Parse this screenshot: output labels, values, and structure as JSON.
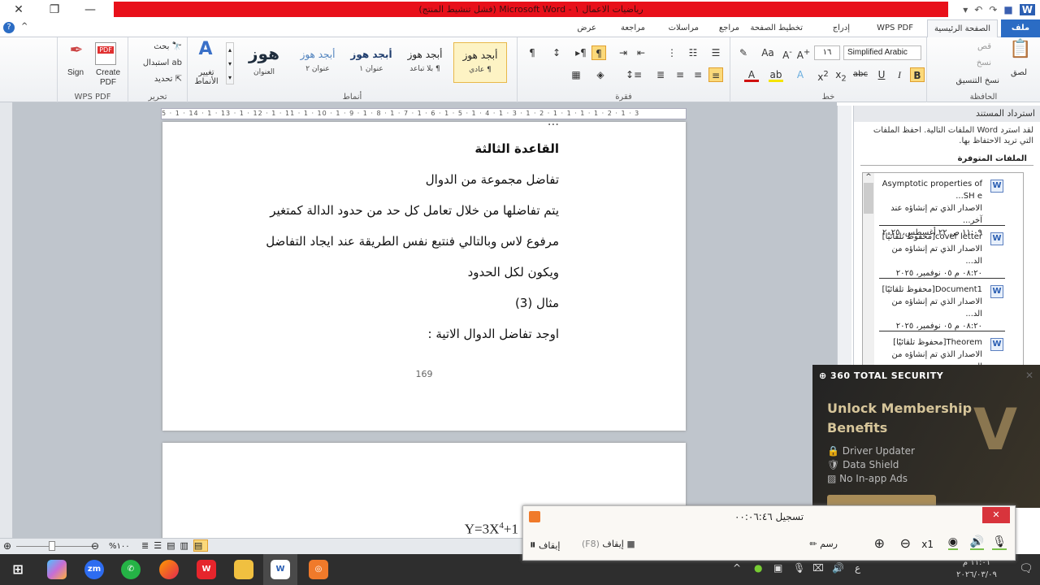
{
  "window": {
    "title": "رياضيات الاعمال ١ - Microsoft Word (فشل تنشيط المنتج)",
    "accent": "#e8101a"
  },
  "tabs": [
    {
      "label": "ملف"
    },
    {
      "label": "الصفحة الرئيسية"
    },
    {
      "label": "WPS PDF"
    },
    {
      "label": "إدراج"
    },
    {
      "label": "تخطيط الصفحة"
    },
    {
      "label": "مراجع"
    },
    {
      "label": "مراسلات"
    },
    {
      "label": "مراجعة"
    },
    {
      "label": "عرض"
    }
  ],
  "ribbon": {
    "clipboard": {
      "label": "الحافظة",
      "paste": "لصق",
      "cut": "قص",
      "copy": "نسخ",
      "format_painter": "نسخ التنسيق"
    },
    "font": {
      "label": "خط",
      "font_name": "Simplified Arabic",
      "font_size": "١٦"
    },
    "paragraph": {
      "label": "فقرة"
    },
    "styles": {
      "label": "أنماط",
      "items": [
        {
          "preview": "أبجد هوز",
          "name": "¶ عادي"
        },
        {
          "preview": "أبجد هوز",
          "name": "¶ بلا تباعد"
        },
        {
          "preview": "أبجد هوز",
          "name": "عنوان ١"
        },
        {
          "preview": "أبجد هوز",
          "name": "عنوان ٢"
        },
        {
          "preview": "هوز",
          "name": "العنوان"
        }
      ],
      "change_styles": "تغيير الأنماط"
    },
    "editing": {
      "label": "تحرير",
      "find": "بحث",
      "replace": "استبدال",
      "select": "تحديد"
    },
    "wps": {
      "label": "WPS PDF",
      "create": "Create PDF",
      "sign": "Sign"
    }
  },
  "ruler": "5 · 1 · 14 · 1 · 13 · 1 · 12 · 1 · 11 · 1 · 10 · 1 · 9 · 1 · 8 · 1 · 7 · 1 · 6 · 1 · 5 · 1 · 4 · 1 · 3 · 1 · 2 · 1 · 1 · 1 · 1 · 2 · 1 · 3",
  "document": {
    "lines": [
      "القاعدة الثالثة",
      "تفاضل مجموعة من الدوال",
      "يتم تفاضلها من خلال تعامل كل حد من حدود الدالة كمتغير",
      "مرفوع لاس وبالتالي فنتبع نفس الطريقة عند ايجاد التفاضل",
      "ويكون لكل الحدود",
      "مثال (3)",
      "اوجد تفاضل الدوال الاتية :"
    ],
    "page_number": "169",
    "equation": {
      "base": "Y=3X",
      "exp": "4",
      "rest": "+1"
    }
  },
  "recovery_pane": {
    "title": "استرداد المستند",
    "message": "لقد استرد Word الملفات التالية. احفظ الملفات التي تريد الاحتفاظ بها.",
    "available": "الملفات المتوفرة",
    "files": [
      {
        "name": "Asymptotic properties of SH e...",
        "desc": "الاصدار الذي تم إنشاؤه عند آخر...",
        "time": "١١:٠٩ ص ٢٢ أغسطس، ٢٠٢٥"
      },
      {
        "name": "cover letter[محفوظ تلقائيًا]",
        "desc": "الاصدار الذي تم إنشاؤه من الد...",
        "time": "٠٨:٢٠ م ٠٥ نوفمبر، ٢٠٢٥"
      },
      {
        "name": "Document1[محفوظ تلقائيًا]",
        "desc": "الاصدار الذي تم إنشاؤه من الد...",
        "time": "٠٨:٢٠ م ٠٥ نوفمبر، ٢٠٢٥"
      },
      {
        "name": "Theorem[محفوظ تلقائيًا]",
        "desc": "الاصدار الذي تم إنشاؤه من الد...",
        "time": ""
      }
    ]
  },
  "security_popup": {
    "brand": "360 TOTAL SECURITY",
    "headline": "Unlock Membership Benefits",
    "features": [
      "Driver Updater",
      "Data Shield",
      "No In-app Ads"
    ]
  },
  "recorder": {
    "status": "تسجيل ٠٠:٠٦:٤٦",
    "pause": "إيقاف",
    "stop": "إيقاف",
    "stop_key": "(F8)",
    "draw": "رسم",
    "zoom": "x1"
  },
  "statusbar": {
    "zoom": "%١٠٠",
    "zoom_percent": 100
  },
  "taskbar": {
    "apps": [
      "Start",
      "Copilot",
      "Zoom",
      "WhatsApp",
      "Firefox",
      "WPS",
      "File Explorer",
      "Word",
      "Recorder"
    ],
    "time": "١١:٠١ م",
    "date": "٢٠٢٦/٠٣/٠٩",
    "lang": "ع"
  }
}
